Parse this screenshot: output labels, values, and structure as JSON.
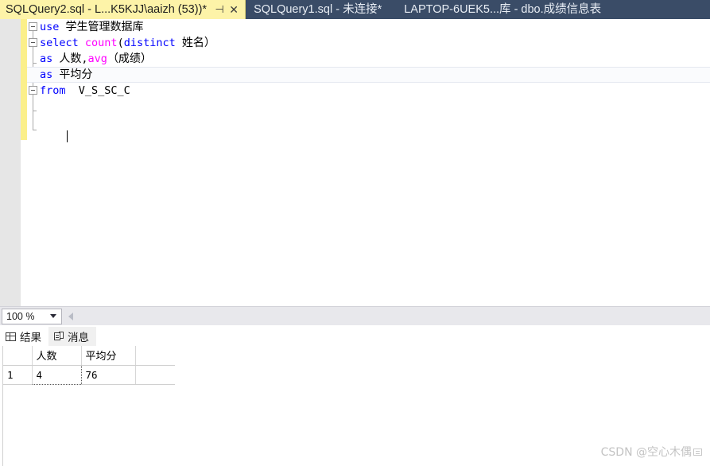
{
  "window": {
    "tabs": [
      {
        "title": "SQLQuery2.sql - L...K5KJJ\\aaizh (53))*",
        "state": "active",
        "pin_icon": "pin-icon",
        "close_icon": "close-icon",
        "pin_glyph": "⊣",
        "close_glyph": "✕"
      },
      {
        "title": "SQLQuery1.sql - 未连接*",
        "state": "inactive"
      },
      {
        "title": "LAPTOP-6UEK5...库 - dbo.成绩信息表",
        "state": "inactive"
      }
    ]
  },
  "editor": {
    "lines": [
      {
        "fold": "open",
        "tokens": [
          {
            "t": "use",
            "c": "kw"
          },
          {
            "t": " ",
            "c": "id"
          },
          {
            "t": "学生管理数据库",
            "c": "cjk"
          }
        ]
      },
      {
        "fold": "open",
        "tokens": [
          {
            "t": "select",
            "c": "kw"
          },
          {
            "t": " ",
            "c": "id"
          },
          {
            "t": "count",
            "c": "fn"
          },
          {
            "t": "(",
            "c": "id"
          },
          {
            "t": "distinct",
            "c": "kw"
          },
          {
            "t": " ",
            "c": "id"
          },
          {
            "t": "姓名",
            "c": "cjk"
          },
          {
            "t": "）",
            "c": "cjk"
          }
        ]
      },
      {
        "fold": "none",
        "tokens": [
          {
            "t": "as",
            "c": "kw"
          },
          {
            "t": " ",
            "c": "id"
          },
          {
            "t": "人数",
            "c": "cjk"
          },
          {
            "t": ",",
            "c": "id"
          },
          {
            "t": "avg",
            "c": "fn"
          },
          {
            "t": "（成绩）",
            "c": "cjk"
          }
        ]
      },
      {
        "fold": "open",
        "current": true,
        "tokens": [
          {
            "t": "as",
            "c": "kw"
          },
          {
            "t": " ",
            "c": "id"
          },
          {
            "t": "平均分",
            "c": "cjk"
          }
        ]
      },
      {
        "fold": "none",
        "tokens": [
          {
            "t": "from",
            "c": "kw"
          },
          {
            "t": "  V_S_SC_C",
            "c": "id"
          }
        ]
      }
    ]
  },
  "zoombar": {
    "zoom_level": "100 %",
    "dropdown_icon": "chevron-down-icon",
    "scroll_left_icon": "scroll-left-arrow-icon"
  },
  "results": {
    "tabs": [
      {
        "label": "结果",
        "icon": "grid-icon",
        "state": "active"
      },
      {
        "label": "消息",
        "icon": "message-icon",
        "state": "inactive"
      }
    ],
    "grid": {
      "row_header_label": "",
      "columns": [
        "人数",
        "平均分"
      ],
      "rows": [
        {
          "num": "1",
          "cells": [
            "4",
            "76"
          ]
        }
      ],
      "selected_cell": {
        "row": 0,
        "col": 0
      }
    }
  },
  "watermark": {
    "text": "CSDN @空心木偶",
    "badge_icon": "csdn-badge-icon"
  },
  "colors": {
    "tab_active_bg": "#fdf3a8",
    "tabstrip_bg": "#3a4c67",
    "keyword": "#0000ff",
    "function": "#ff00ff",
    "change_bar": "#fbef8a",
    "selected_cell_bg": "#dce6f1"
  }
}
